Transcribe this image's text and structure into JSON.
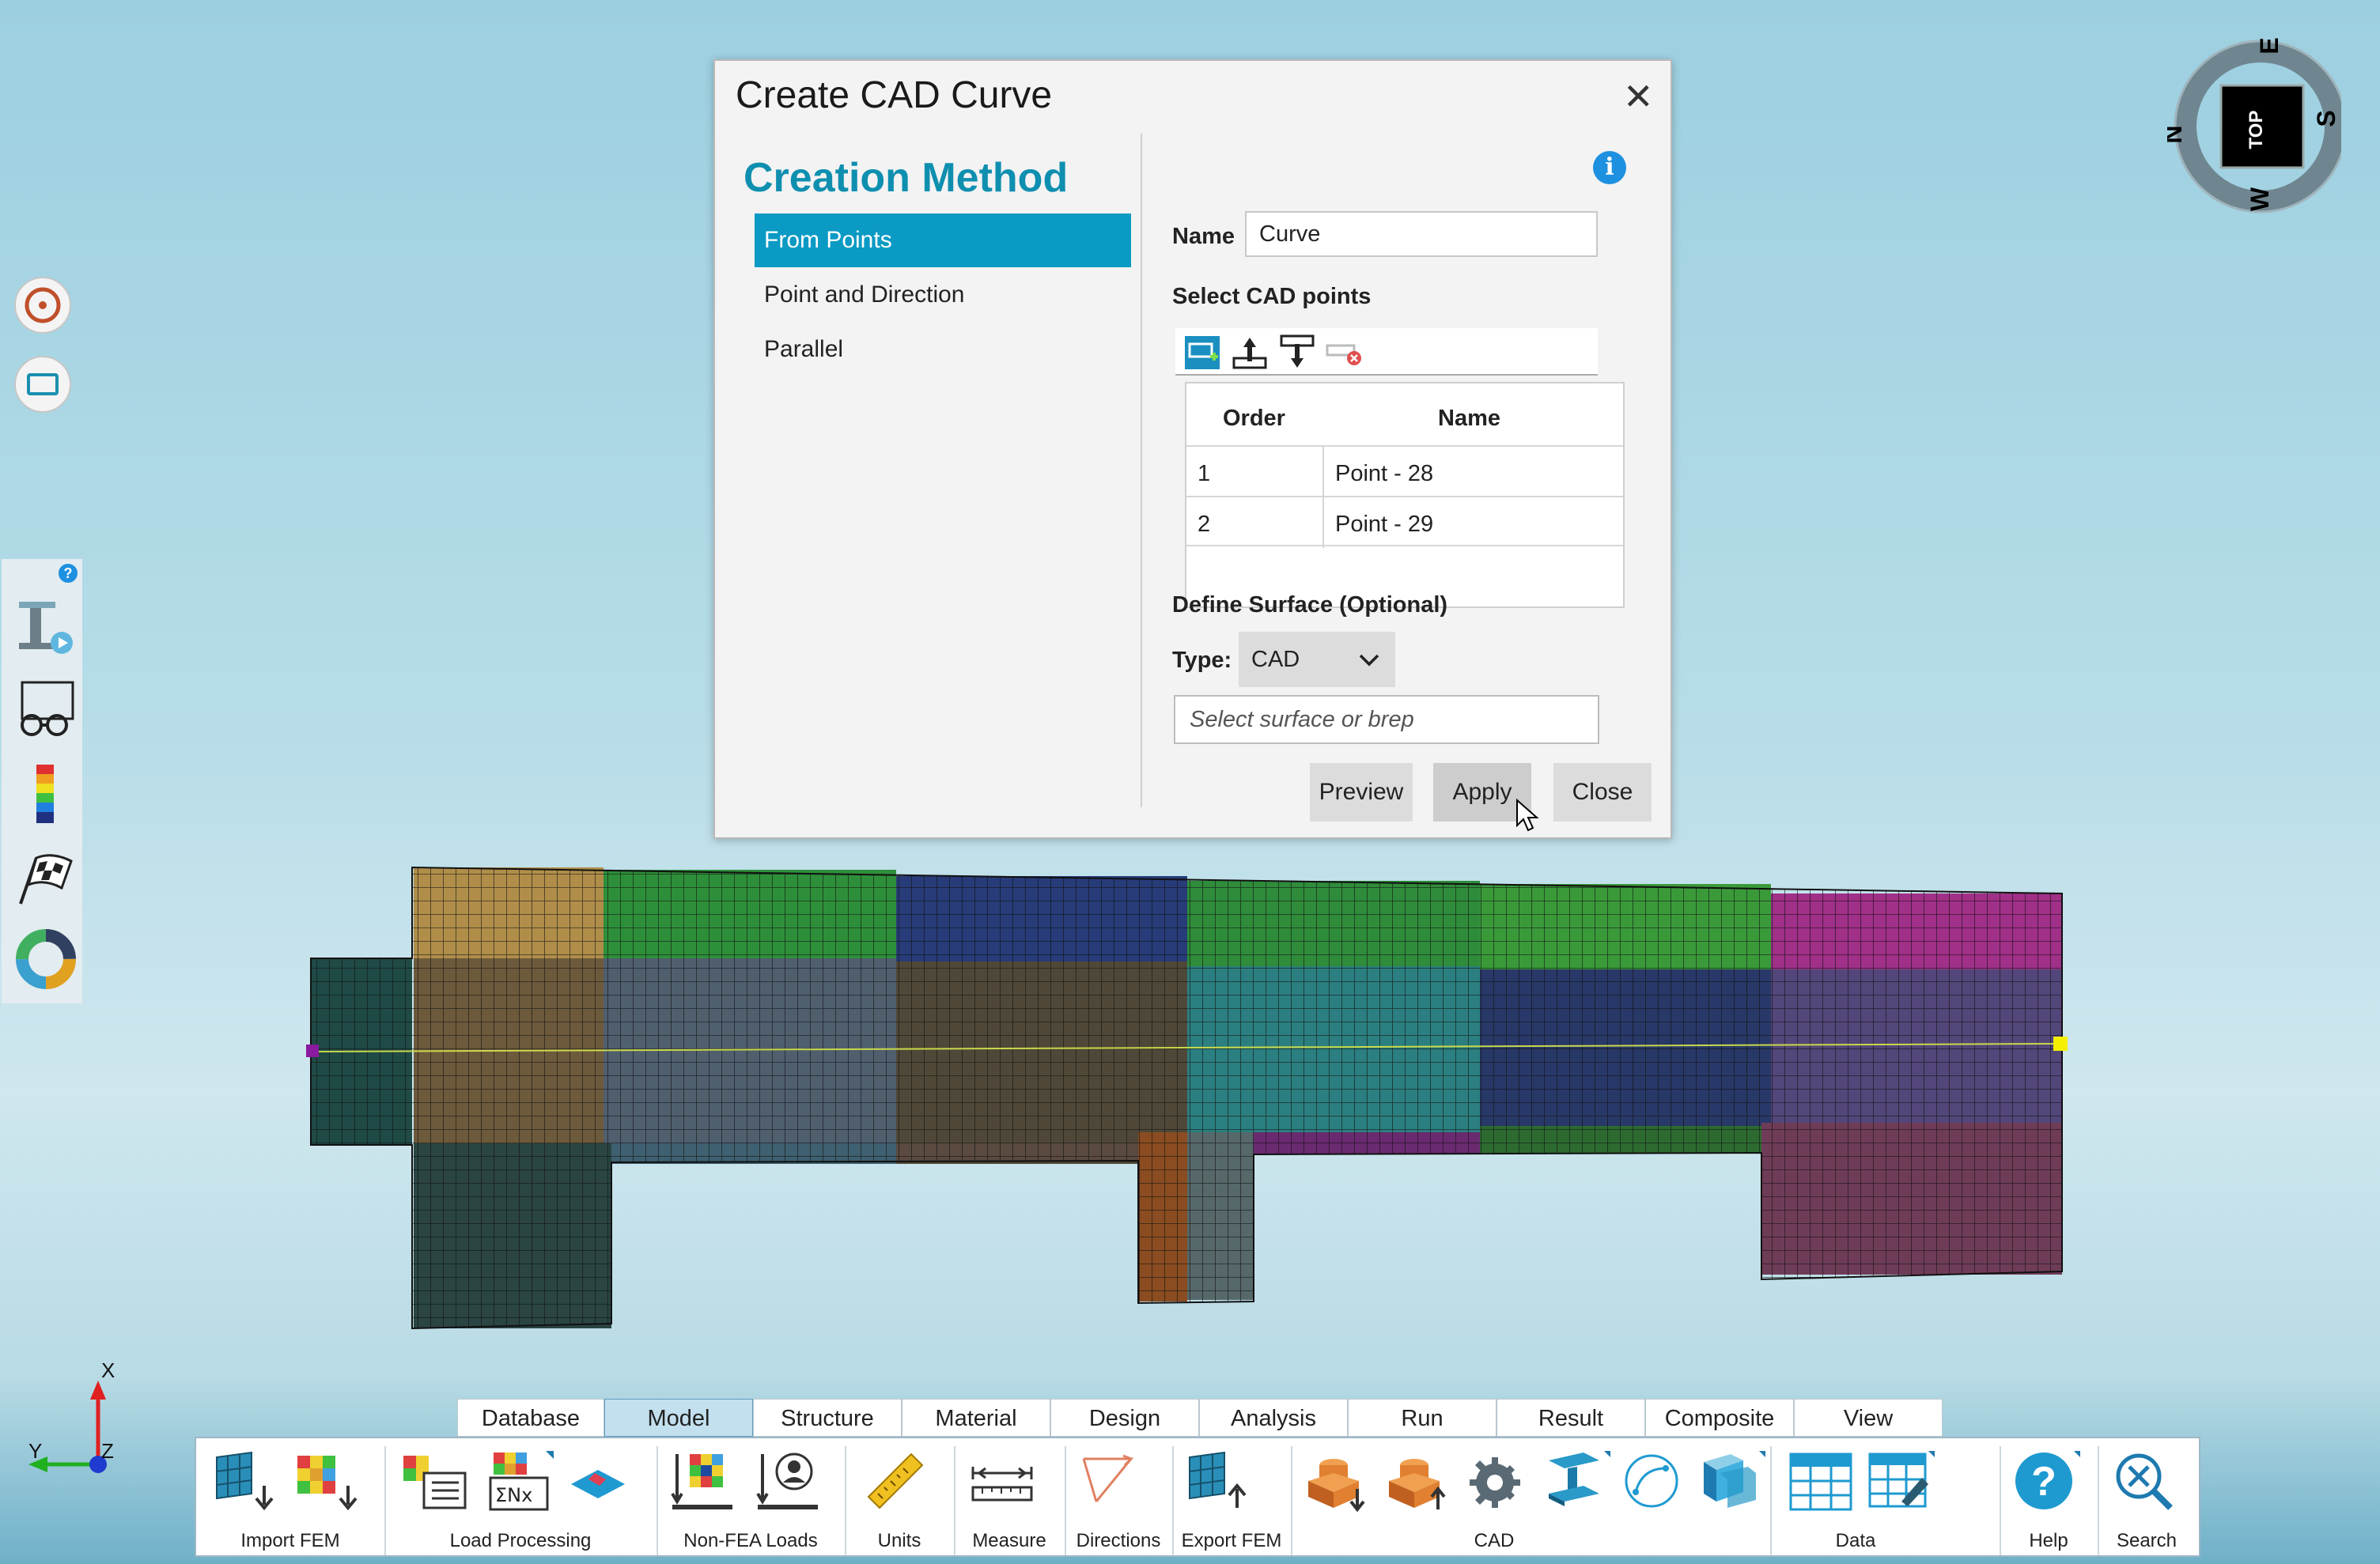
{
  "dialog": {
    "title": "Create CAD Curve",
    "close_glyph": "✕",
    "creation_method_heading": "Creation Method",
    "methods": [
      {
        "label": "From Points",
        "selected": true
      },
      {
        "label": "Point and Direction",
        "selected": false
      },
      {
        "label": "Parallel",
        "selected": false
      }
    ],
    "info_glyph": "i",
    "name_label": "Name",
    "name_value": "Curve",
    "select_points_label": "Select CAD points",
    "points_table": {
      "headers": [
        "Order",
        "Name"
      ],
      "rows": [
        {
          "order": "1",
          "name": "Point - 28"
        },
        {
          "order": "2",
          "name": "Point - 29"
        }
      ]
    },
    "define_surface_label": "Define Surface (Optional)",
    "type_label": "Type:",
    "type_value": "CAD",
    "surface_placeholder": "Select surface or brep",
    "buttons": {
      "preview": "Preview",
      "apply": "Apply",
      "close": "Close"
    }
  },
  "compass": {
    "center": "TOP",
    "n": "N",
    "e": "E",
    "s": "S",
    "w": "W"
  },
  "side_panel": {
    "help_glyph": "?"
  },
  "axes": {
    "x": "X",
    "y": "Y",
    "z": "Z"
  },
  "ribbon": {
    "tabs": [
      "Database",
      "Model",
      "Structure",
      "Material",
      "Design",
      "Analysis",
      "Run",
      "Result",
      "Composite",
      "View"
    ],
    "selected_tab": "Model",
    "groups": [
      "Import FEM",
      "Load Processing",
      "Non-FEA Loads",
      "Units",
      "Measure",
      "Directions",
      "Export FEM",
      "CAD",
      "Data",
      "Help",
      "Search"
    ]
  },
  "colors": {
    "accent": "#0a9ac4",
    "heading": "#0f8fb0",
    "info": "#1e90e0"
  }
}
